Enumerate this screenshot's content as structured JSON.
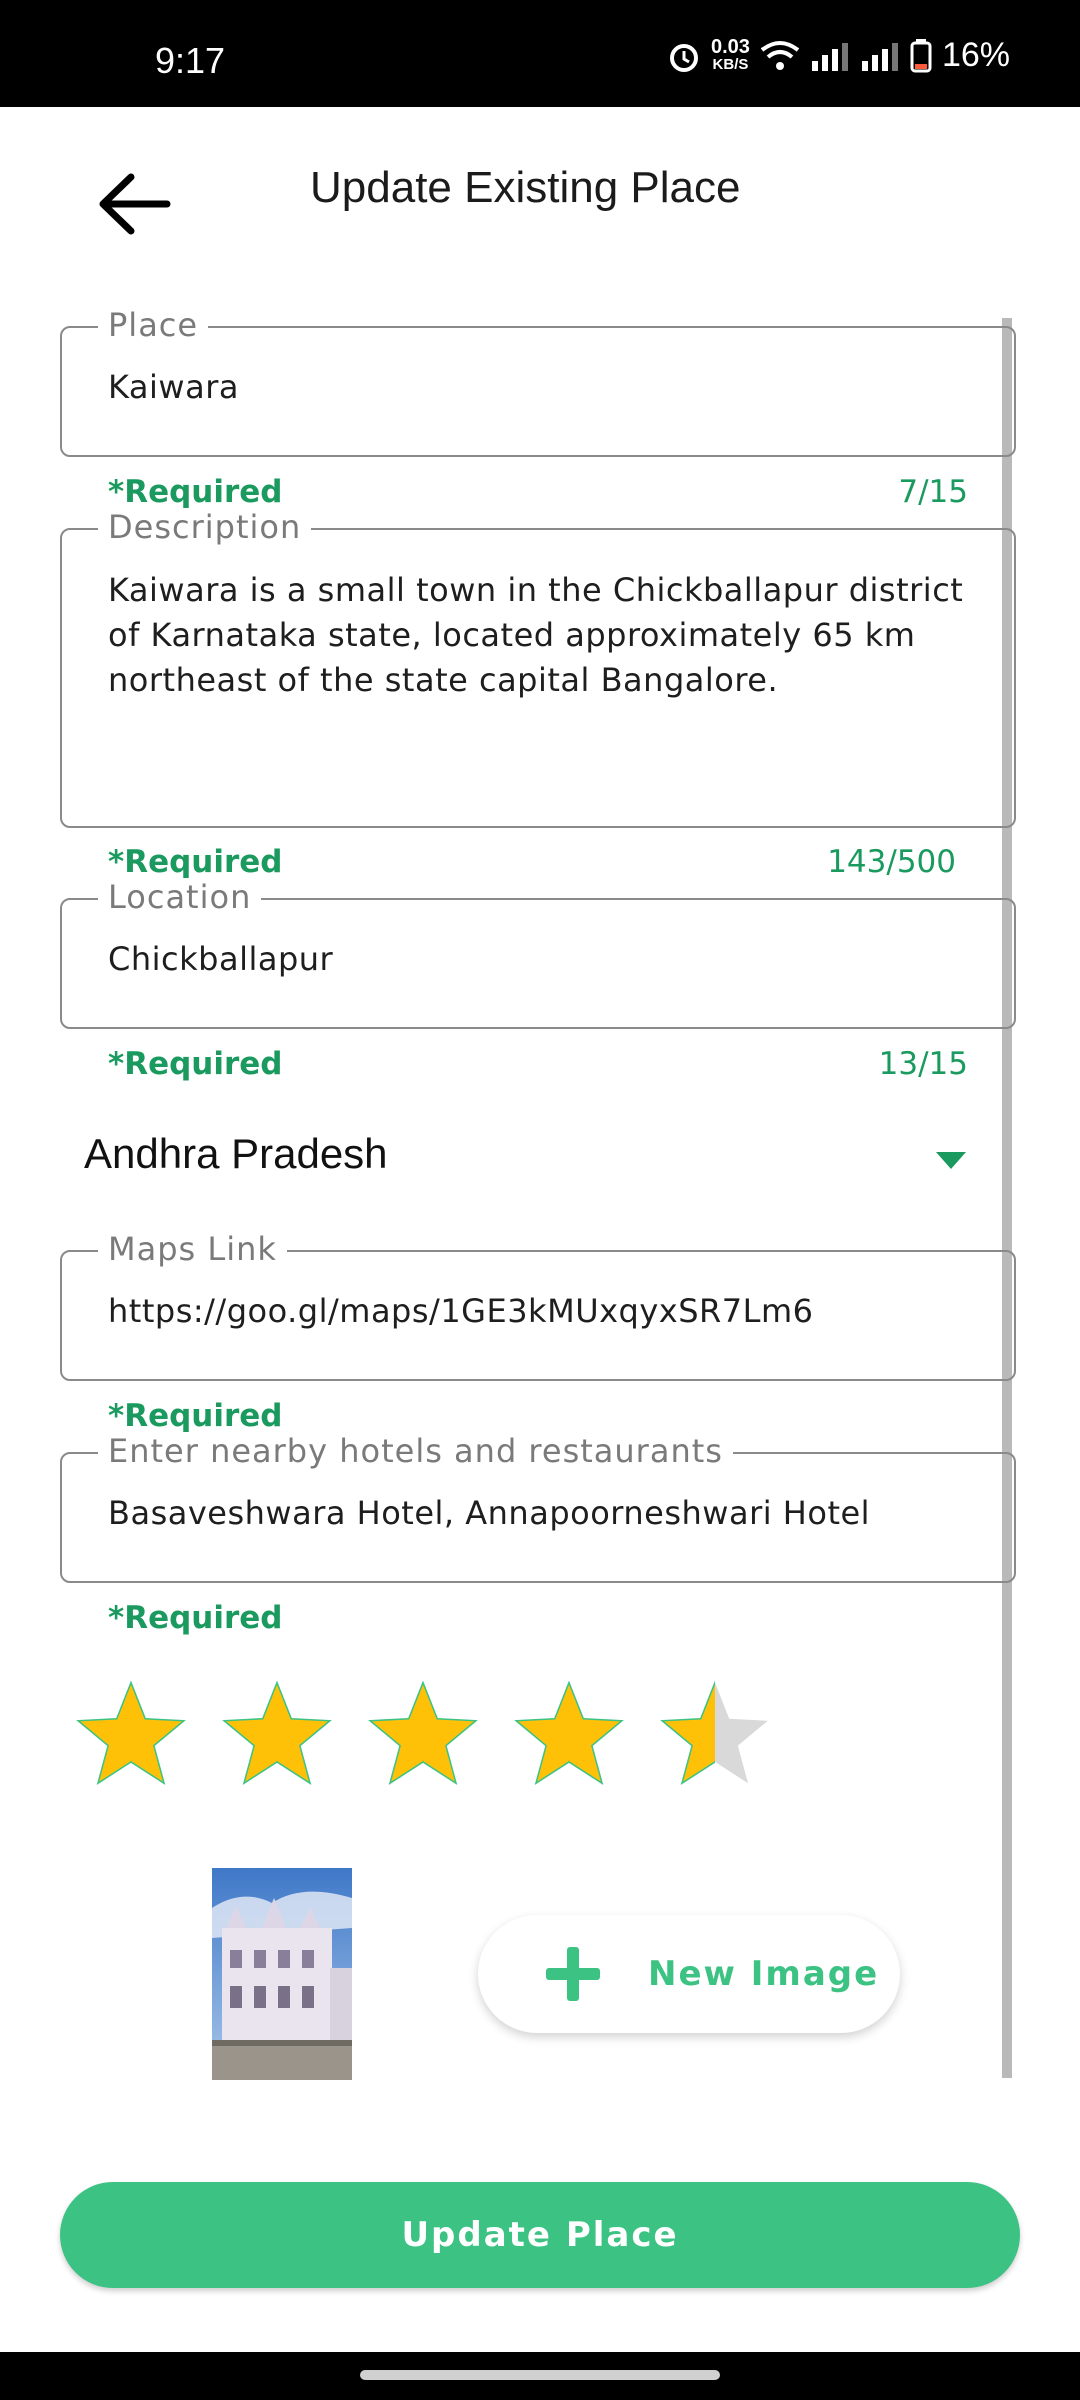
{
  "status_bar": {
    "time": "9:17",
    "speed_value": "0.03",
    "speed_unit": "KB/S",
    "battery": "16%",
    "icons": [
      "alarm-icon",
      "wifi-icon",
      "signal-icon",
      "signal-icon",
      "battery-icon"
    ]
  },
  "header": {
    "title": "Update Existing Place",
    "back_icon": "arrow-left-icon"
  },
  "form": {
    "place": {
      "label": "Place",
      "value": "Kaiwara",
      "helper": "*Required",
      "counter": "7/15"
    },
    "description": {
      "label": "Description",
      "value": "Kaiwara is a small town in the Chickballapur district of Karnataka state, located approximately 65 km northeast of the state capital Bangalore.",
      "helper": "*Required",
      "counter": "143/500"
    },
    "location": {
      "label": "Location",
      "value": "Chickballapur",
      "helper": "*Required",
      "counter": "13/15"
    },
    "state": {
      "selected": "Andhra Pradesh"
    },
    "maps": {
      "label": "Maps Link",
      "value": "https://goo.gl/maps/1GE3kMUxqyxSR7Lm6",
      "helper": "*Required"
    },
    "hotels": {
      "label": "Enter nearby hotels and restaurants",
      "value": "Basaveshwara Hotel, Annapoorneshwari Hotel",
      "helper": "*Required"
    },
    "rating": {
      "value": 4.5,
      "max": 5
    },
    "new_image_label": "New Image"
  },
  "actions": {
    "update_label": "Update Place"
  },
  "colors": {
    "accent": "#3cc283",
    "helper_green": "#1a9a5e",
    "star": "#ffc107",
    "star_empty": "#d9d9d9"
  }
}
